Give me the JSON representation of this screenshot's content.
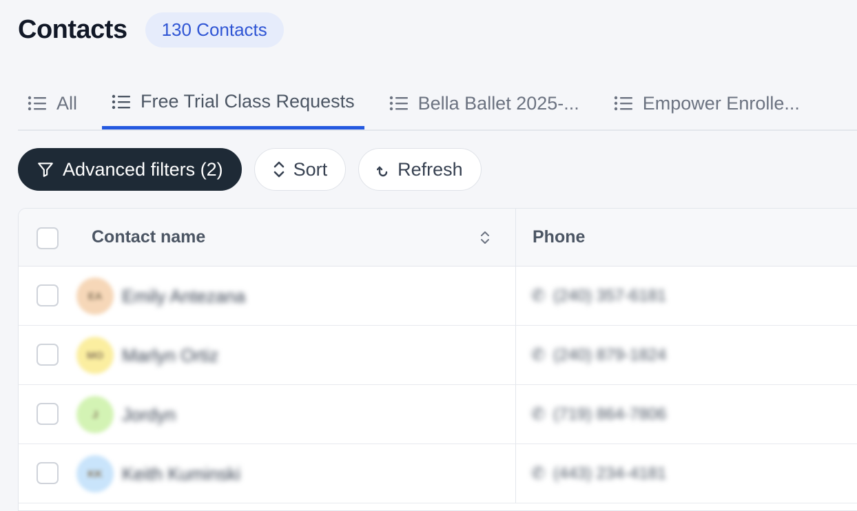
{
  "header": {
    "title": "Contacts",
    "count_badge": "130 Contacts"
  },
  "tabs": [
    {
      "label": "All",
      "active": false
    },
    {
      "label": "Free Trial Class Requests",
      "active": true
    },
    {
      "label": "Bella Ballet 2025-...",
      "active": false
    },
    {
      "label": "Empower Enrolle...",
      "active": false
    }
  ],
  "toolbar": {
    "advanced_filters_label": "Advanced filters (2)",
    "sort_label": "Sort",
    "refresh_label": "Refresh"
  },
  "table": {
    "columns": [
      "Contact name",
      "Phone"
    ],
    "rows": [
      {
        "initials": "EA",
        "name": "Emily Antezana",
        "phone": "(240) 357-6181",
        "avatar_color": "#f6d7b8"
      },
      {
        "initials": "MO",
        "name": "Marlyn Ortiz",
        "phone": "(240) 879-1824",
        "avatar_color": "#fbeea0"
      },
      {
        "initials": "J",
        "name": "Jordyn",
        "phone": "(719) 864-7806",
        "avatar_color": "#d3f3b4"
      },
      {
        "initials": "KK",
        "name": "Keith Kuminski",
        "phone": "(443) 234-4181",
        "avatar_color": "#c9e4fb"
      }
    ]
  },
  "colors": {
    "accent": "#2459e0",
    "badge_bg": "#e6ecfb",
    "dark_button": "#1e2a36"
  }
}
